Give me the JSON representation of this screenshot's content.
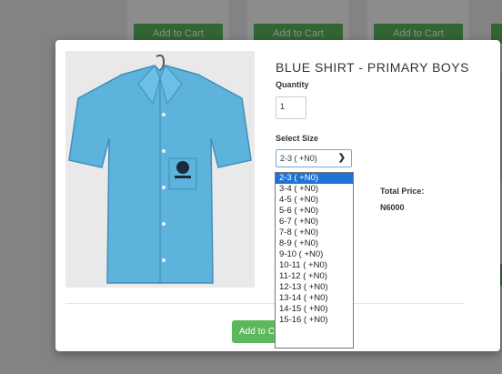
{
  "background": {
    "add_to_cart_buttons": [
      "Add to Cart",
      "Add to Cart",
      "Add to Cart"
    ]
  },
  "modal": {
    "product_title": "BLUE SHIRT - PRIMARY BOYS",
    "quantity_label": "Quantity",
    "quantity_value": "1",
    "size_label": "Select Size",
    "size_selected": "2-3 ( +N0)",
    "total_price_label": "Total Price:",
    "total_price_value": "N6000",
    "add_to_cart_label": "Add to Cart"
  },
  "size_options": [
    "2-3 ( +N0)",
    "3-4 ( +N0)",
    "4-5 ( +N0)",
    "5-6 ( +N0)",
    "6-7 ( +N0)",
    "7-8 ( +N0)",
    "8-9 ( +N0)",
    "9-10 ( +N0)",
    "10-11 ( +N0)",
    "11-12 ( +N0)",
    "12-13 ( +N0)",
    "13-14 ( +N0)",
    "14-15 ( +N0)",
    "15-16 ( +N0)"
  ],
  "colors": {
    "button_green": "#5cb85c",
    "selected_option_blue": "#1e73d8",
    "shirt_blue": "#5eb3dc"
  }
}
